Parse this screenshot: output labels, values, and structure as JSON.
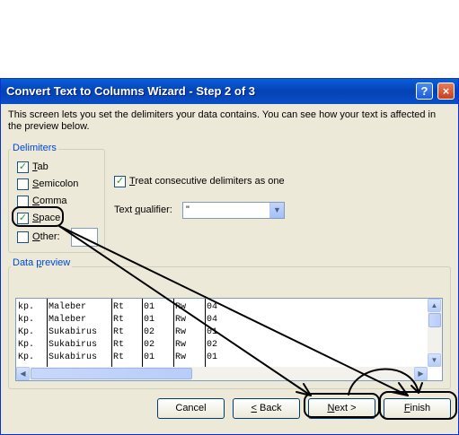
{
  "window": {
    "title": "Convert Text to Columns Wizard - Step 2 of 3",
    "help_icon": "?",
    "close_icon": "×"
  },
  "description": "This screen lets you set the delimiters your data contains.  You can see how your text is affected in the preview below.",
  "delimiters": {
    "label": "Delimiters",
    "items": [
      {
        "label": "Tab",
        "accel": "T",
        "rest": "ab",
        "checked": true
      },
      {
        "label": "Semicolon",
        "accel": "S",
        "rest": "emicolon",
        "checked": false
      },
      {
        "label": "Comma",
        "accel": "C",
        "rest": "omma",
        "checked": false
      },
      {
        "label": "Space",
        "accel": "S",
        "rest": "pace",
        "checked": true
      },
      {
        "label": "Other:",
        "accel": "O",
        "rest": "ther:",
        "checked": false
      }
    ],
    "other_value": ""
  },
  "treat_consecutive": {
    "accel": "T",
    "rest": "reat consecutive delimiters as one",
    "checked": true
  },
  "text_qualifier": {
    "pre": "Text ",
    "accel": "q",
    "post": "ualifier:",
    "value": "\""
  },
  "data_preview": {
    "label_pre": "Data ",
    "accel": "p",
    "label_post": "review",
    "rows": [
      [
        "kp.",
        "Maleber",
        "Rt",
        "01",
        "Rw",
        "04"
      ],
      [
        "kp.",
        "Maleber",
        "Rt",
        "01",
        "Rw",
        "04"
      ],
      [
        "Kp.",
        "Sukabirus",
        "Rt",
        "02",
        "Rw",
        "01"
      ],
      [
        "Kp.",
        "Sukabirus",
        "Rt",
        "02",
        "Rw",
        "02"
      ],
      [
        "Kp.",
        "Sukabirus",
        "Rt",
        "01",
        "Rw",
        "01"
      ]
    ]
  },
  "buttons": {
    "cancel": "Cancel",
    "back_accel": "<",
    "back_rest": " Back",
    "next_accel": "N",
    "next_rest": "ext >",
    "finish_accel": "F",
    "finish_rest": "inish"
  },
  "check_glyph": "✓"
}
